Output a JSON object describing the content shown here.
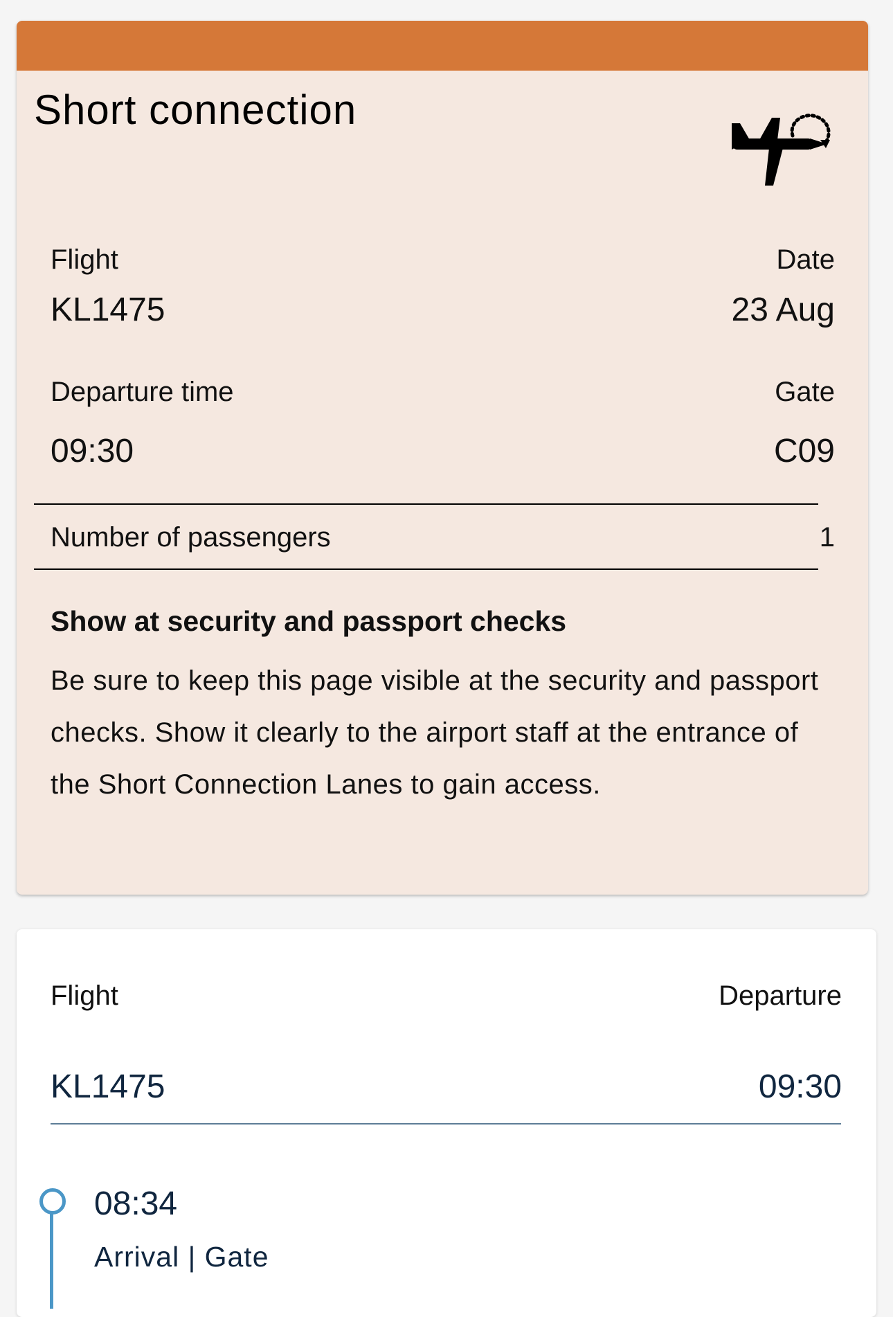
{
  "connection_card": {
    "title": "Short connection",
    "icon": "plane-connection-icon",
    "accent_color": "#d57838",
    "background_color": "#f5e8e0",
    "flight_label": "Flight",
    "flight_value": "KL1475",
    "date_label": "Date",
    "date_value": "23 Aug",
    "departure_label": "Departure time",
    "departure_value": "09:30",
    "gate_label": "Gate",
    "gate_value": "C09",
    "passengers_label": "Number of passengers",
    "passengers_value": "1",
    "notice_title": "Show at security and passport checks",
    "notice_body": "Be sure to keep this page visible at the security and passport checks. Show it clearly to the airport staff at the entrance of the Short Connection Lanes to gain access."
  },
  "flight_card": {
    "flight_label": "Flight",
    "departure_label": "Departure",
    "flight_value": "KL1475",
    "departure_value": "09:30",
    "timeline": [
      {
        "time": "08:34",
        "label": "Arrival | Gate"
      }
    ],
    "timeline_color": "#4b97c7"
  }
}
